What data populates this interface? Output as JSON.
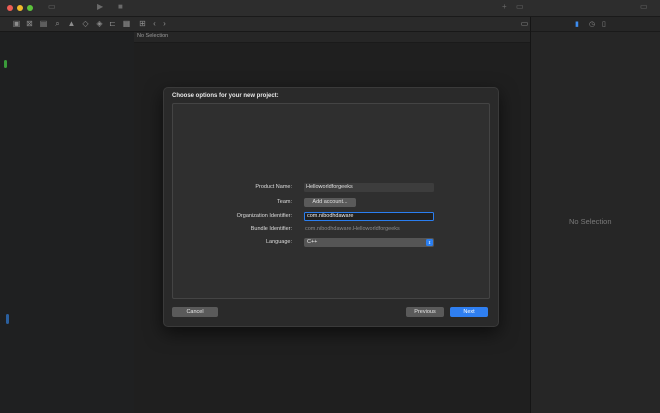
{
  "editor": {
    "header_label": "No Selection"
  },
  "inspector": {
    "no_selection_label": "No Selection"
  },
  "sheet": {
    "title": "Choose options for your new project:",
    "fields": {
      "product_name": {
        "label": "Product Name:",
        "value": "Helloworldforgeeks"
      },
      "team": {
        "label": "Team:",
        "button_label": "Add account..."
      },
      "organization_identifier": {
        "label": "Organization Identifier:",
        "value": "com.nibodhdaware"
      },
      "bundle_identifier": {
        "label": "Bundle Identifier:",
        "value": "com.nibodhdaware.Helloworldforgeeks"
      },
      "language": {
        "label": "Language:",
        "selected": "C++"
      }
    },
    "buttons": {
      "cancel": "Cancel",
      "previous": "Previous",
      "next": "Next"
    }
  },
  "colors": {
    "accent": "#2f7ff1",
    "sheet_bg": "#2a2a2a",
    "window_bg": "#1f1f1f"
  }
}
